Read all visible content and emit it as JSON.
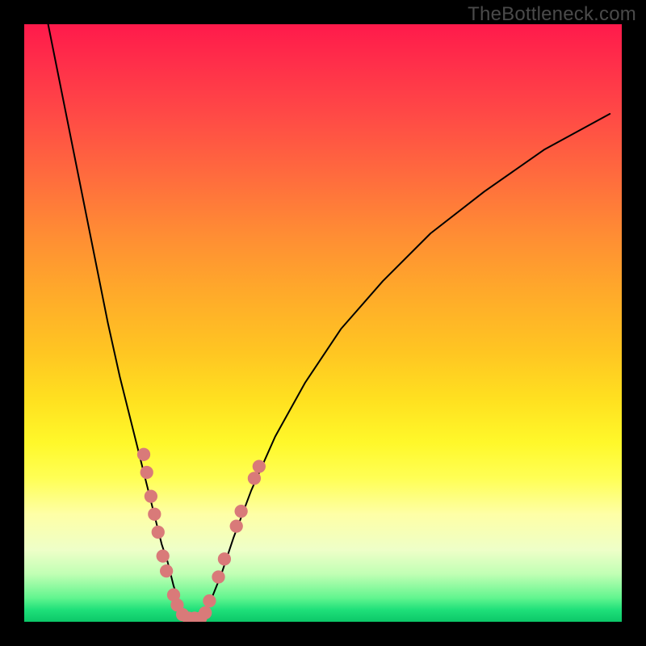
{
  "watermark": "TheBottleneck.com",
  "chart_data": {
    "type": "line",
    "title": "",
    "xlabel": "",
    "ylabel": "",
    "x_range": [
      0,
      100
    ],
    "y_range": [
      0,
      100
    ],
    "grid": false,
    "series": [
      {
        "name": "left-branch",
        "x": [
          4,
          6,
          8,
          10,
          12,
          14,
          16,
          18,
          20,
          21,
          22,
          23,
          24,
          25,
          26,
          27
        ],
        "y": [
          100,
          90,
          80,
          70,
          60,
          50,
          41,
          33,
          25,
          21,
          17,
          13,
          10,
          6,
          3,
          0.5
        ]
      },
      {
        "name": "right-branch",
        "x": [
          30,
          31,
          33,
          35,
          38,
          42,
          47,
          53,
          60,
          68,
          77,
          87,
          98
        ],
        "y": [
          0.5,
          3,
          8,
          14,
          22,
          31,
          40,
          49,
          57,
          65,
          72,
          79,
          85
        ]
      }
    ],
    "valley_floor": {
      "name": "valley-floor",
      "x": [
        27,
        30
      ],
      "y": [
        0.5,
        0.5
      ]
    },
    "markers": {
      "name": "sample-points",
      "color": "#d97a79",
      "radius_pct": 1.1,
      "points": [
        {
          "x": 20.0,
          "y": 28.0
        },
        {
          "x": 20.5,
          "y": 25.0
        },
        {
          "x": 21.2,
          "y": 21.0
        },
        {
          "x": 21.8,
          "y": 18.0
        },
        {
          "x": 22.4,
          "y": 15.0
        },
        {
          "x": 23.2,
          "y": 11.0
        },
        {
          "x": 23.8,
          "y": 8.5
        },
        {
          "x": 25.0,
          "y": 4.5
        },
        {
          "x": 25.6,
          "y": 2.8
        },
        {
          "x": 26.5,
          "y": 1.2
        },
        {
          "x": 27.5,
          "y": 0.6
        },
        {
          "x": 28.5,
          "y": 0.6
        },
        {
          "x": 29.5,
          "y": 0.6
        },
        {
          "x": 30.3,
          "y": 1.5
        },
        {
          "x": 31.0,
          "y": 3.5
        },
        {
          "x": 32.5,
          "y": 7.5
        },
        {
          "x": 33.5,
          "y": 10.5
        },
        {
          "x": 35.5,
          "y": 16.0
        },
        {
          "x": 36.3,
          "y": 18.5
        },
        {
          "x": 38.5,
          "y": 24.0
        },
        {
          "x": 39.3,
          "y": 26.0
        }
      ]
    },
    "colors": {
      "curve": "#000000",
      "marker": "#d97a79",
      "frame": "#000000"
    }
  }
}
